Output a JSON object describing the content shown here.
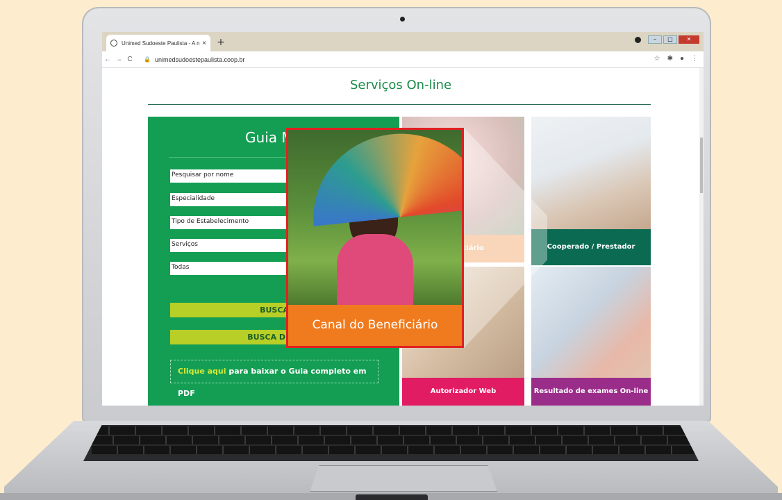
{
  "browser": {
    "tab_title": "Unimed Sudoeste Paulista - A m",
    "tab_close": "×",
    "new_tab": "+",
    "url": "unimedsudoestepaulista.coop.br",
    "icons": [
      "back-icon",
      "forward-icon",
      "reload-icon",
      "lock-icon",
      "star-icon",
      "extensions-icon",
      "profile-icon",
      "menu-icon"
    ]
  },
  "page": {
    "title": "Serviços On-line"
  },
  "guia": {
    "title": "Guia Mé",
    "fields": [
      "Pesquisar por nome",
      "Especialidade",
      "Tipo de Estabelecimento",
      "Serviços",
      "Todas"
    ],
    "busca_label": "BUSCA",
    "busca_detalhada_label": "BUSCA DETA",
    "pdf_link": "Clique aqui",
    "pdf_text": " para baixar o Guia completo em PDF"
  },
  "tiles": {
    "beneficiario": "eneficiário",
    "cooperado": "Cooperado / Prestador",
    "autorizador": "Autorizador Web",
    "exames": "Resultado de exames On-line"
  },
  "highlight": {
    "label": "Canal do Beneficiário"
  },
  "colors": {
    "background": "#fdeccd",
    "guia_green": "#149e53",
    "lime": "#b7cf27",
    "orange": "#f07b1e",
    "teal": "#0b6b52",
    "pink": "#e21c63",
    "purple": "#9b2d8a",
    "highlight_border": "#e02121"
  }
}
